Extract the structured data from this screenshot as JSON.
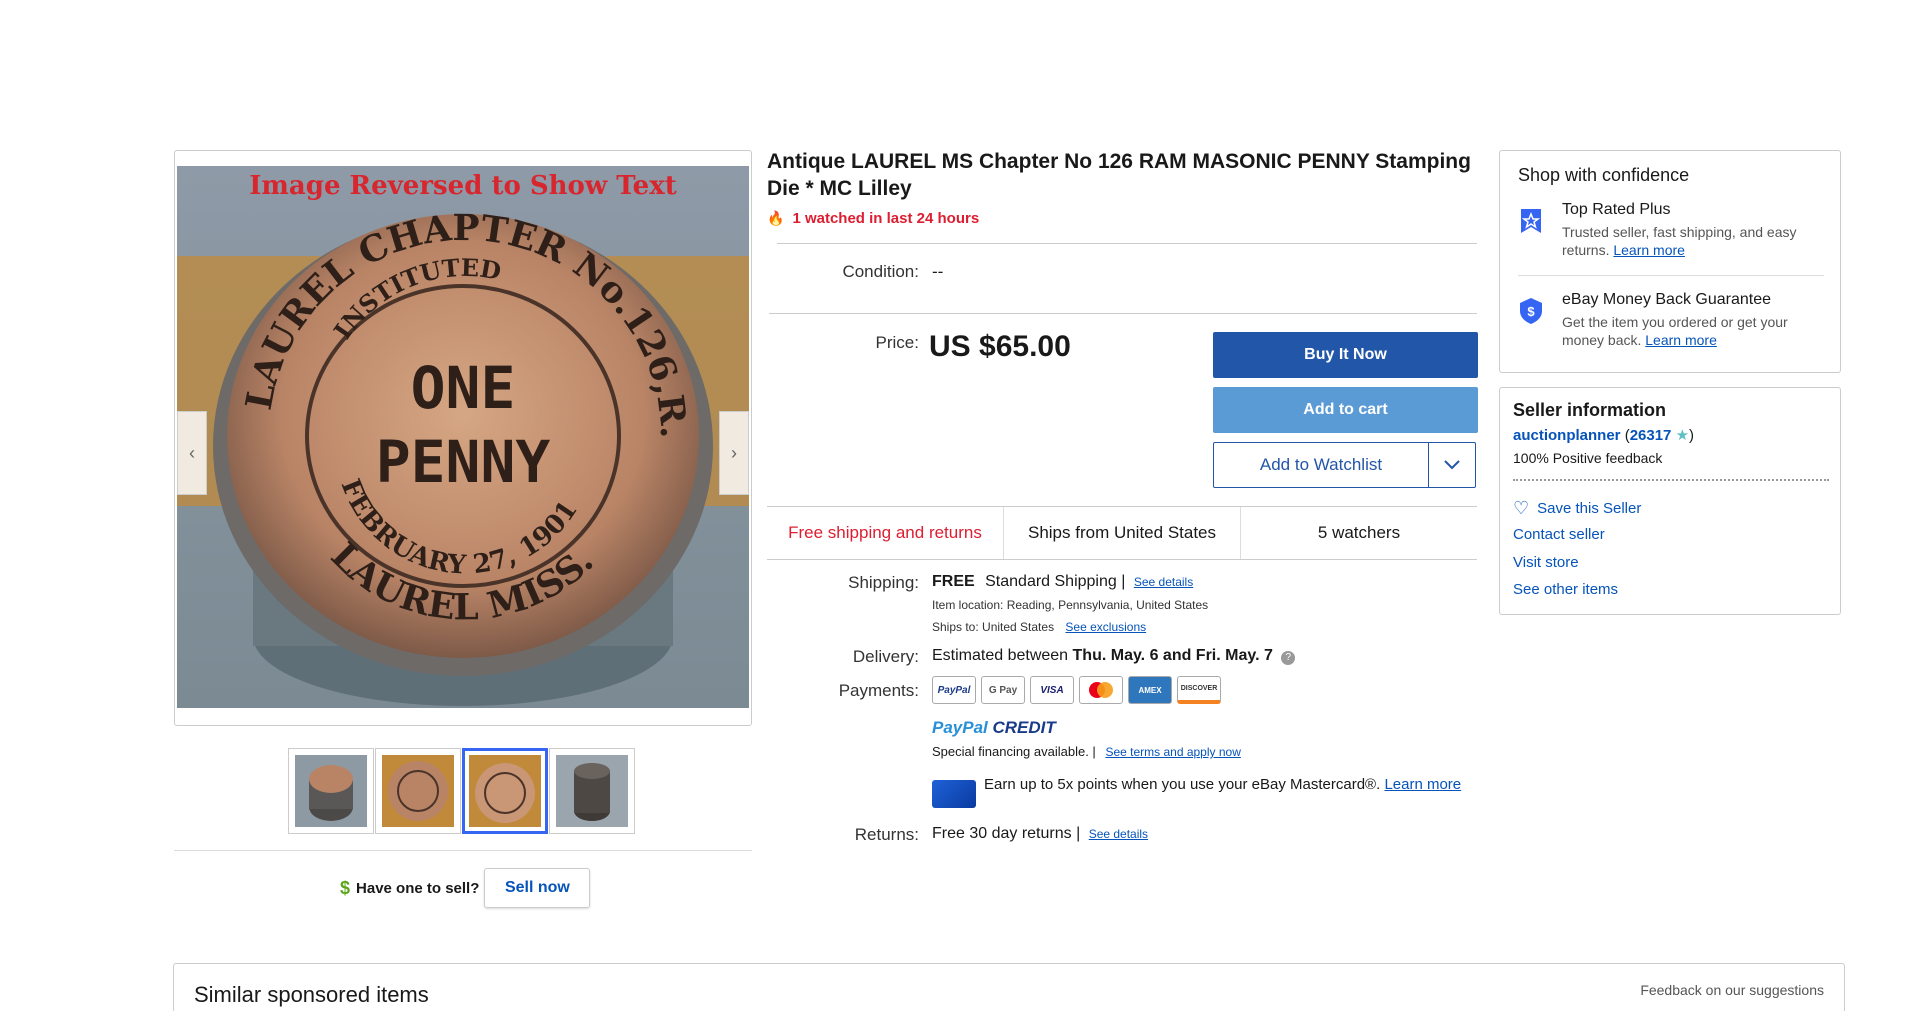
{
  "gallery": {
    "image_caption": "Image Reversed to Show Text",
    "coin_text": {
      "outer": "LAUREL CHAPTER No.126,R.A.M.",
      "inner": "INSTITUTED",
      "center_top": "ONE",
      "center_bottom": "PENNY",
      "date": "FEBRUARY 27, 1901",
      "bottom": "LAUREL MISS."
    },
    "prev_arrow": "‹",
    "next_arrow": "›",
    "thumbnails_count": 4,
    "active_thumbnail": 3
  },
  "sell": {
    "icon": "$",
    "prompt": "Have one to sell?",
    "button": "Sell now"
  },
  "item": {
    "title": "Antique LAUREL MS Chapter No 126 RAM MASONIC PENNY Stamping Die * MC Lilley",
    "watched": "1 watched in last 24 hours",
    "condition_label": "Condition:",
    "condition_value": "--",
    "price_label": "Price:",
    "price_value": "US $65.00"
  },
  "actions": {
    "buy_it_now": "Buy It Now",
    "add_to_cart": "Add to cart",
    "add_to_watchlist": "Add to Watchlist"
  },
  "info_strip": {
    "free_shipping": "Free shipping and returns",
    "ships_from": "Ships from United States",
    "watchers": "5 watchers"
  },
  "shipping": {
    "label": "Shipping:",
    "free": "FREE",
    "service": "Standard Shipping |",
    "see_details": "See details",
    "item_location": "Item location:  Reading, Pennsylvania, United States",
    "ships_to": "Ships to:  United States",
    "see_exclusions": "See exclusions"
  },
  "delivery": {
    "label": "Delivery:",
    "prefix": "Estimated between",
    "dates": "Thu. May. 6 and Fri. May. 7"
  },
  "payments": {
    "label": "Payments:",
    "logos": [
      "PayPal",
      "G Pay",
      "VISA",
      "MC",
      "AMEX",
      "DISCOVER"
    ],
    "paypal_credit_a": "PayPal",
    "paypal_credit_b": "CREDIT",
    "special_financing": "Special financing available.  |",
    "see_terms": "See terms and apply now",
    "mastercard_text": "Earn up to 5x points when you use your eBay Mastercard®.",
    "learn_more": "Learn more"
  },
  "returns": {
    "label": "Returns:",
    "text": "Free 30 day returns |",
    "see_details": "See details"
  },
  "confidence": {
    "title": "Shop with confidence",
    "top_rated_title": "Top Rated Plus",
    "top_rated_desc": "Trusted seller, fast shipping, and easy returns.",
    "money_back_title": "eBay Money Back Guarantee",
    "money_back_desc": "Get the item you ordered or get your money back.",
    "learn_more": "Learn more"
  },
  "seller": {
    "title": "Seller information",
    "name": "auctionplanner",
    "score": "26317",
    "positive": "100% Positive feedback",
    "save": "Save this Seller",
    "contact": "Contact seller",
    "visit_store": "Visit store",
    "other_items": "See other items"
  },
  "similar": {
    "title": "Similar sponsored items",
    "feedback": "Feedback on our suggestions"
  },
  "colors": {
    "accent_blue": "#2256a8",
    "cart_blue": "#5b9bd5",
    "alert_red": "#dd1e31",
    "link_blue": "#0654ba"
  }
}
